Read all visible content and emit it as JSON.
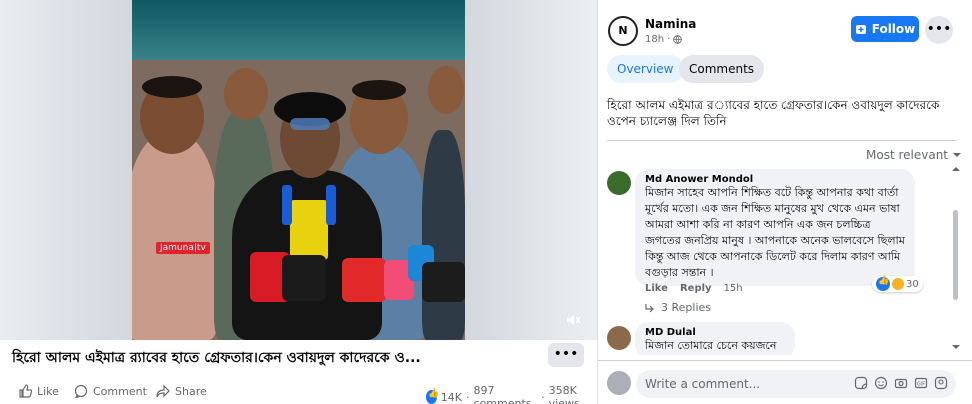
{
  "video": {
    "watermark": "Jamuna",
    "watermark_tv": "tv",
    "title": "হিরো আলম এইমাত্র র‍্যাবের হাতে গ্রেফতার।কেন ওবায়দুল কাদেরকে ও..."
  },
  "actions": {
    "like_label": "Like",
    "comment_label": "Comment",
    "share_label": "Share",
    "reactions_count": "14K",
    "comments_count": "897 comments",
    "views_count": "358K views"
  },
  "post": {
    "page_name": "Namina",
    "avatar_letter": "N",
    "time": "18h",
    "follow_label": "Follow",
    "caption": "হিরো আলম এইমাত্র র◌্যাবের হাতে গ্রেফতার।কেন ওবায়দুল কাদেরকে ওপেন চ্যালেঞ্জ দিল তিনি"
  },
  "tabs": {
    "overview": "Overview",
    "comments": "Comments"
  },
  "sort": {
    "label": "Most relevant"
  },
  "comments": [
    {
      "name": "Md Anower Mondol",
      "text": "মিজান সাহেব আপনি শিক্ষিত বটে কিন্তু আপনার কথা বার্তা মূর্খের মতো। এক জন শিক্ষিত মানুষের মুখ থেকে এমন ভাষা আমরা আশা করি না কারণ আপনি এক জন চলচ্চিত্র জগতের জনপ্রিয় মানুষ । আপনাকে অনেক ভালবেসে ছিলাম কিন্তু আজ থেকে আপনাকে ডিলেট করে দিলাম কারণ আমি বগুড়ার সন্তান ।",
      "like": "Like",
      "reply": "Reply",
      "time": "15h",
      "reaction_count": "30",
      "replies": "3 Replies"
    },
    {
      "name": "MD Dulal",
      "text": "মিজান তোমারে চেনে কয়জনে"
    }
  ],
  "composer": {
    "placeholder": "Write a comment..."
  },
  "colors": {
    "accent": "#1877f2",
    "text": "#050505",
    "muted": "#65676b",
    "bubble": "#f0f2f5"
  }
}
